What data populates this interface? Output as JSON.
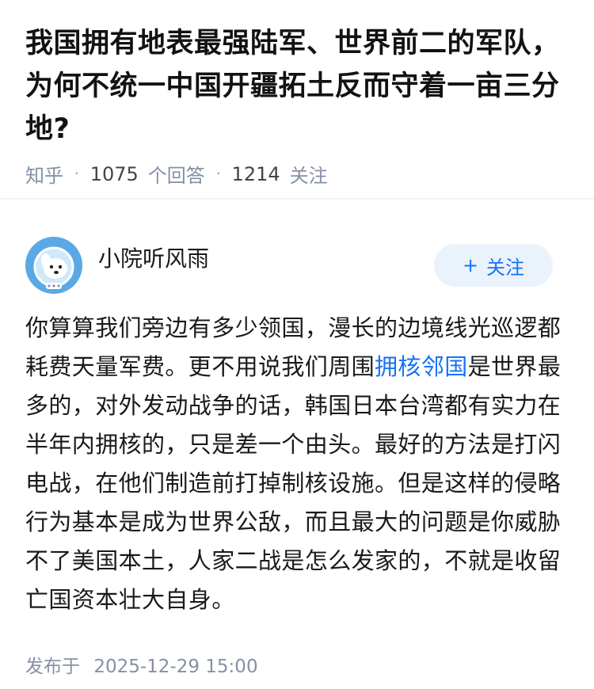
{
  "question": {
    "title": "我国拥有地表最强陆军、世界前二的军队，为何不统一中国开疆拓土反而守着一亩三分地?",
    "source": "知乎",
    "answer_count": "1075",
    "answer_label": "个回答",
    "follow_count": "1214",
    "follow_label": "关注"
  },
  "author": {
    "name": "小院听风雨",
    "follow_button": "关注",
    "avatar_icon": "cartoon-dog-astronaut"
  },
  "answer": {
    "text_before": "你算算我们旁边有多少领国，漫长的边境线光巡逻都耗费天量军费。更不用说我们周围",
    "link_text": "拥核邻国",
    "text_after": "是世界最多的，对外发动战争的话，韩国日本台湾都有实力在半年内拥核的，只是差一个由头。最好的方法是打闪电战，在他们制造前打掉制核设施。但是这样的侵略行为基本是成为世界公敌，而且最大的问题是你威胁不了美国本土，人家二战是怎么发家的，不就是收留亡国资本壮大自身。"
  },
  "footer": {
    "published_label": "发布于",
    "published_time": "2025-12-29 15:00"
  },
  "colors": {
    "link": "#1772f6",
    "meta": "#8590a6",
    "follow_bg": "#eaf2fb"
  }
}
